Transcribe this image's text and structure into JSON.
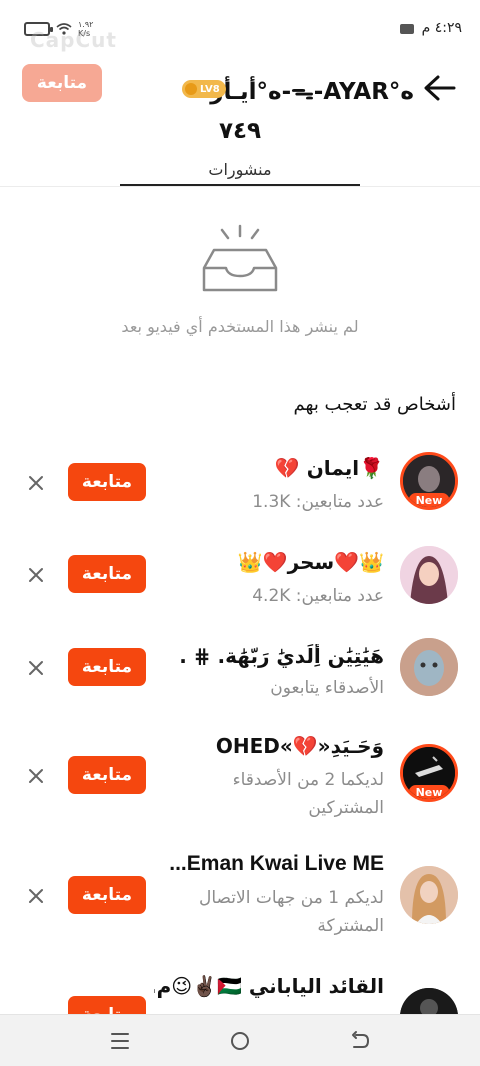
{
  "status_bar": {
    "time": "٤:٢٩ م",
    "net_speed_top": "١.٩٢",
    "net_speed_bottom": "K/s",
    "watermark": "CapCut"
  },
  "header": {
    "follow_label": "متابعة",
    "username": "ﻩ°أيـأر-ᯓ-AYAR°ﻩ",
    "level": "LV8",
    "posts_count": "٧٤٩",
    "posts_tab": "منشورات"
  },
  "empty_state": {
    "text": "لم ينشر هذا المستخدم أي فيديو بعد"
  },
  "suggestions": {
    "title": "أشخاص قد تعجب بهم",
    "follow_label": "متابعة",
    "users": [
      {
        "name": "🌹ايمان 💔",
        "sub": "عدد متابعين: 1.3K",
        "badge": "New"
      },
      {
        "name": "👑❤️سحر❤️👑",
        "sub": "عدد متابعين: 4.2K",
        "badge": ""
      },
      {
        "name": "هَيَٰتِيَٰن أِلَديَٰ رَبّهَٰة. ⋕ .",
        "sub": "الأصدقاء يتابعون",
        "badge": ""
      },
      {
        "name": "وَحَـيَدِ«💔»OHED",
        "sub": "لديكما 2 من الأصدقاء المشتركين",
        "badge": "New"
      },
      {
        "name": "Eman Kwai Live ME...",
        "sub": "لديكم 1 من جهات الاتصال المشتركة",
        "badge": ""
      },
      {
        "name": "القائد الياباني 🇵🇸✌🏿😉م...",
        "sub": "",
        "badge": ""
      }
    ]
  },
  "colors": {
    "accent": "#f5470f",
    "accent_faded": "#f6a894",
    "badge_gold": "#f2b84b",
    "sub_text": "#8c8c8c"
  },
  "nav": {
    "icons": [
      "menu-icon",
      "home-circle-icon",
      "back-icon"
    ]
  }
}
